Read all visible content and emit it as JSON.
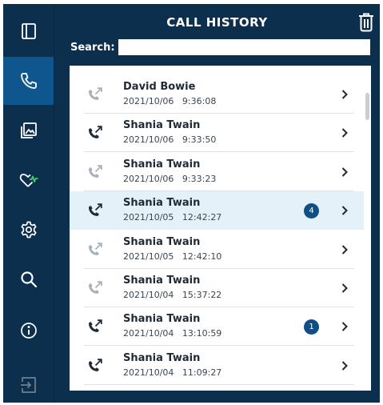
{
  "header": {
    "title": "CALL HISTORY"
  },
  "search": {
    "label": "Search:",
    "value": "",
    "placeholder": ""
  },
  "sidebar": {
    "items": [
      {
        "name": "sidebar-item-panel",
        "icon": "panel-icon"
      },
      {
        "name": "sidebar-item-calls",
        "icon": "phone-icon",
        "active": true
      },
      {
        "name": "sidebar-item-gallery",
        "icon": "image-icon"
      },
      {
        "name": "sidebar-item-health",
        "icon": "heart-pulse-icon"
      },
      {
        "name": "sidebar-item-settings",
        "icon": "gear-icon"
      },
      {
        "name": "sidebar-item-search",
        "icon": "magnifier-icon"
      },
      {
        "name": "sidebar-item-info",
        "icon": "info-icon"
      },
      {
        "name": "sidebar-item-logout",
        "icon": "exit-icon"
      }
    ]
  },
  "calls": [
    {
      "name": "David Bowie",
      "date": "2021/10/06",
      "time": "9:36:08",
      "type": "missed",
      "badge": ""
    },
    {
      "name": "Shania Twain",
      "date": "2021/10/06",
      "time": "9:33:50",
      "type": "outgoing",
      "badge": ""
    },
    {
      "name": "Shania Twain",
      "date": "2021/10/06",
      "time": "9:33:23",
      "type": "missed",
      "badge": ""
    },
    {
      "name": "Shania Twain",
      "date": "2021/10/05",
      "time": "12:42:27",
      "type": "outgoing",
      "badge": "4",
      "selected": true
    },
    {
      "name": "Shania Twain",
      "date": "2021/10/05",
      "time": "12:42:10",
      "type": "missed",
      "badge": ""
    },
    {
      "name": "Shania Twain",
      "date": "2021/10/04",
      "time": "15:37:22",
      "type": "missed",
      "badge": ""
    },
    {
      "name": "Shania Twain",
      "date": "2021/10/04",
      "time": "13:10:59",
      "type": "outgoing",
      "badge": "1"
    },
    {
      "name": "Shania Twain",
      "date": "2021/10/04",
      "time": "11:09:27",
      "type": "outgoing",
      "badge": ""
    }
  ],
  "colors": {
    "sidebar_bg": "#0d2f4e",
    "sidebar_active": "#0f568f",
    "selected_row": "#e5f1f9",
    "badge": "#0f4f86",
    "outgoing_icon": "#1f2a36",
    "missed_icon": "#a9b1b8"
  }
}
